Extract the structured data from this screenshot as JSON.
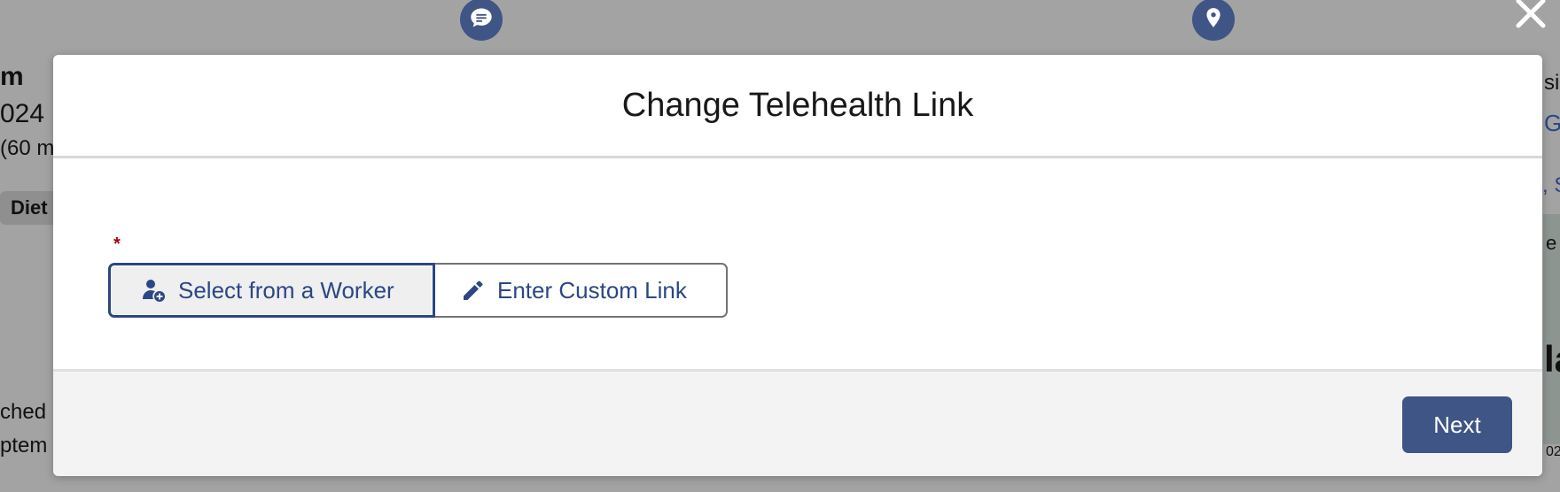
{
  "background": {
    "left_fragments": [
      "m",
      "024",
      "(60 m",
      "Diet",
      "ched",
      "ptem"
    ],
    "right_fragments": [
      "si",
      "G",
      ", S",
      "e",
      "la",
      "02"
    ]
  },
  "icons": {
    "chat": "chat-bubble-icon",
    "location": "map-pin-icon",
    "close": "close-icon",
    "worker": "user-add-icon",
    "edit": "pencil-icon"
  },
  "modal": {
    "title": "Change Telehealth Link",
    "required_marker": "*",
    "options": {
      "worker_label": "Select from a Worker",
      "custom_label": "Enter Custom Link",
      "selected": "Select from a Worker"
    },
    "footer": {
      "next_label": "Next"
    }
  },
  "colors": {
    "brand": "#3f5585",
    "text_link": "#2b4784",
    "required": "#b00000",
    "overlay": "#a3a3a3"
  }
}
